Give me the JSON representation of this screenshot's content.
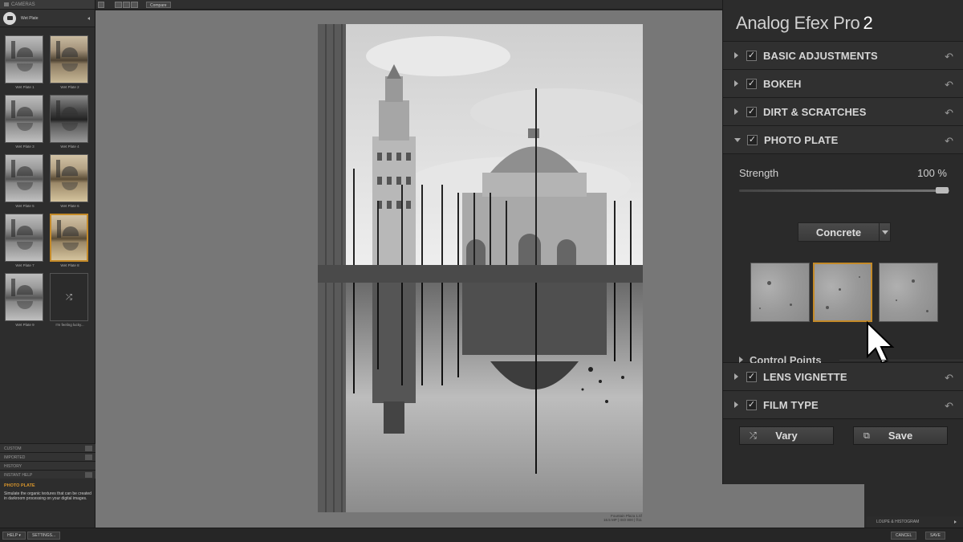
{
  "app": {
    "title": "Analog Efex Pro",
    "version": "2"
  },
  "left": {
    "header": "CAMERAS",
    "preset": "Wet Plate",
    "thumbs": [
      {
        "label": "Wet Plate 1",
        "tone": "bw"
      },
      {
        "label": "Wet Plate 2",
        "tone": "sepia"
      },
      {
        "label": "Wet Plate 3",
        "tone": "bw"
      },
      {
        "label": "Wet Plate 4",
        "tone": "dark"
      },
      {
        "label": "Wet Plate 5",
        "tone": "bw"
      },
      {
        "label": "Wet Plate 6",
        "tone": "sepia2"
      },
      {
        "label": "Wet Plate 7",
        "tone": "bw"
      },
      {
        "label": "Wet Plate 8",
        "tone": "sepia2",
        "selected": true
      },
      {
        "label": "Wet Plate 9",
        "tone": "bw"
      },
      {
        "label": "I'm feeling lucky...",
        "tone": "random"
      }
    ],
    "categories": [
      "CUSTOM",
      "IMPORTED",
      "HISTORY",
      "INSTANT HELP"
    ],
    "help_title": "PHOTO PLATE",
    "help_text": "Simulate the organic textures that can be created in darkroom processing on your digital images."
  },
  "topbar": {
    "compare": "Compare"
  },
  "caption": {
    "line1": "Fountain Plaza 1.tif",
    "line2": "16.5 MP | ISO 800 | f/11"
  },
  "right": {
    "sections_top": [
      {
        "label": "BASIC ADJUSTMENTS",
        "checked": true
      },
      {
        "label": "BOKEH",
        "checked": true
      },
      {
        "label": "DIRT & SCRATCHES",
        "checked": true
      }
    ],
    "photo_plate": {
      "label": "PHOTO PLATE",
      "checked": true,
      "strength_label": "Strength",
      "strength_value": "100 %",
      "strength": 1.0,
      "texture": "Concrete",
      "textures_count": 3,
      "selected_texture": 2,
      "control_points": "Control Points"
    },
    "sections_bottom": [
      {
        "label": "LENS VIGNETTE",
        "checked": true
      },
      {
        "label": "FILM TYPE",
        "checked": true
      }
    ],
    "vary": "Vary",
    "save": "Save"
  },
  "bottom": {
    "help": "HELP",
    "settings": "SETTINGS...",
    "loupe": "LOUPE & HISTOGRAM",
    "cancel": "CANCEL",
    "save": "SAVE"
  },
  "icons": {
    "check": "✓",
    "reset": "↶",
    "shuffle": "⤮",
    "compare": "⧉"
  },
  "colors": {
    "accent": "#c48a28",
    "canvas_bg": "#777777",
    "panel_bg": "#2a2a2a"
  }
}
